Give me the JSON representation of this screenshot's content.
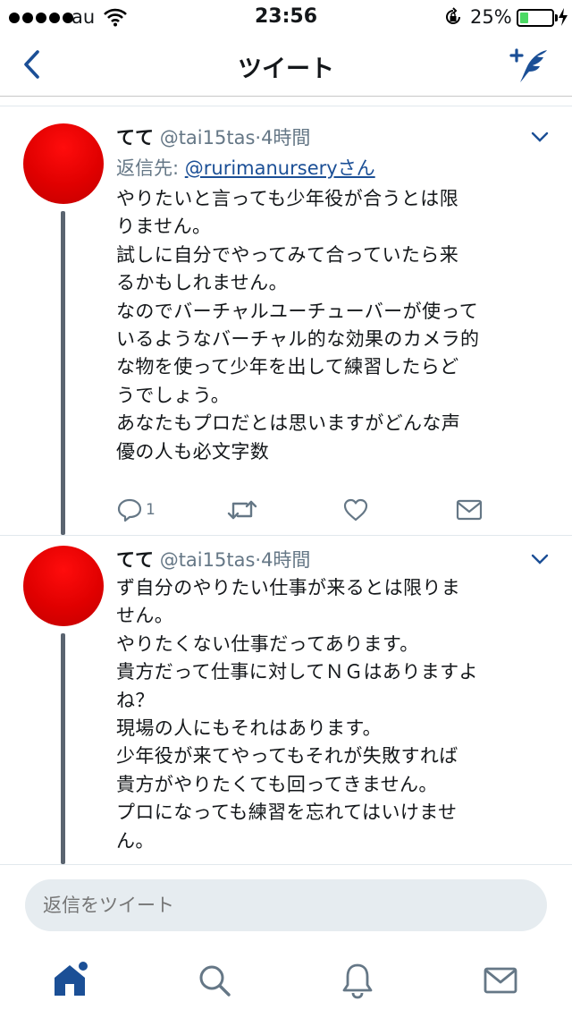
{
  "status_bar": {
    "carrier": "au",
    "time": "23:56",
    "battery_percent": "25%",
    "battery_level": 0.25
  },
  "nav": {
    "title": "ツイート"
  },
  "tweets": [
    {
      "name": "てて",
      "handle": "@tai15tas",
      "time": "·4時間",
      "reply_prefix": "返信先: ",
      "reply_to": "@rurimanurseryさん",
      "lines": [
        "やりたいと言っても少年役が合うとは限",
        "りません。",
        "試しに自分でやってみて合っていたら来",
        "るかもしれません。",
        "なのでバーチャルユーチューバーが使って",
        "いるようなバーチャル的な効果のカメラ的",
        "な物を使って少年を出して練習したらど",
        "うでしょう。",
        "あなたもプロだとは思いますがどんな声",
        "優の人も必文字数"
      ],
      "reply_count": "1"
    },
    {
      "name": "てて",
      "handle": "@tai15tas",
      "time": "·4時間",
      "lines": [
        "ず自分のやりたい仕事が来るとは限りま",
        "せん。",
        "やりたくない仕事だってあります。",
        "貴方だって仕事に対してＮＧはありますよ",
        "ね？",
        "現場の人にもそれはあります。",
        "少年役が来てやってもそれが失敗すれば",
        "貴方がやりたくても回ってきません。",
        "プロになっても練習を忘れてはいけませ",
        "ん。"
      ]
    }
  ],
  "composer": {
    "placeholder": "返信をツイート"
  },
  "colors": {
    "accent": "#1b4f96",
    "avatar": "#e00000",
    "thread_line": "#5a6470",
    "muted": "#657786"
  },
  "icons": {
    "back": "chevron-left-icon",
    "compose": "compose-tweet-icon",
    "reply": "reply-icon",
    "retweet": "retweet-icon",
    "like": "heart-icon",
    "dm": "envelope-icon",
    "home": "home-icon",
    "search": "search-icon",
    "notifications": "bell-icon",
    "messages": "envelope-icon"
  }
}
